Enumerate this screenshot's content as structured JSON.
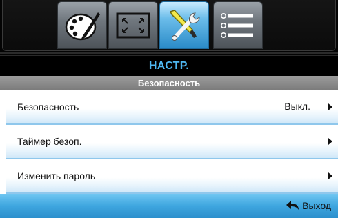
{
  "tabs": [
    {
      "icon": "palette-icon",
      "name": "Image"
    },
    {
      "icon": "display-size-icon",
      "name": "Display"
    },
    {
      "icon": "tools-icon",
      "name": "Setup",
      "active": true
    },
    {
      "icon": "list-icon",
      "name": "Info"
    }
  ],
  "header": {
    "title": "НАСТР.",
    "subtitle": "Безопасность"
  },
  "rows": [
    {
      "label": "Безопасность",
      "value": "Выкл.",
      "has_arrow": true
    },
    {
      "label": "Таймер безоп.",
      "value": "",
      "has_arrow": true
    },
    {
      "label": "Изменить пароль",
      "value": "",
      "has_arrow": true
    }
  ],
  "footer": {
    "exit_label": "Выход",
    "exit_icon": "return-arrow-icon"
  },
  "colors": {
    "accent_blue": "#4fb8f2",
    "active_tab": "#2a8bc8",
    "footer": "#3ea6df",
    "row_border": "#8fc7ec"
  }
}
